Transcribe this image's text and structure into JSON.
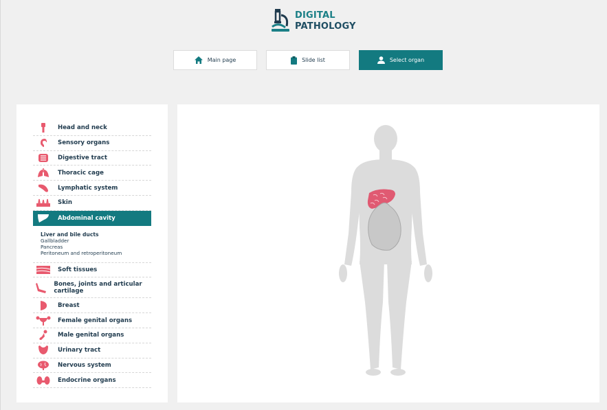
{
  "header": {
    "logo_line1": "DIGITAL",
    "logo_line2": "PATHOLOGY"
  },
  "nav": [
    {
      "label": "Main page",
      "icon": "home-icon"
    },
    {
      "label": "Slide list",
      "icon": "clipboard-icon"
    },
    {
      "label": "Select organ",
      "icon": "user-icon",
      "active": true
    }
  ],
  "organs": [
    {
      "label": "Head and neck",
      "icon": "head-neck-icon"
    },
    {
      "label": "Sensory organs",
      "icon": "ear-icon"
    },
    {
      "label": "Digestive tract",
      "icon": "intestine-icon"
    },
    {
      "label": "Thoracic cage",
      "icon": "lungs-icon"
    },
    {
      "label": "Lymphatic system",
      "icon": "spleen-icon"
    },
    {
      "label": "Skin",
      "icon": "skin-icon"
    },
    {
      "label": "Abdominal cavity",
      "icon": "liver-icon",
      "active": true
    },
    {
      "label": "Soft tissues",
      "icon": "muscle-icon"
    },
    {
      "label": "Bones, joints and articular cartilage",
      "icon": "bone-joint-icon"
    },
    {
      "label": "Breast",
      "icon": "breast-icon"
    },
    {
      "label": "Female genital organs",
      "icon": "uterus-icon"
    },
    {
      "label": "Male genital organs",
      "icon": "male-organ-icon"
    },
    {
      "label": "Urinary tract",
      "icon": "bladder-icon"
    },
    {
      "label": "Nervous system",
      "icon": "brain-icon"
    },
    {
      "label": "Endocrine organs",
      "icon": "thyroid-icon"
    }
  ],
  "subitems": [
    "Liver and bile ducts",
    "Gallbladder",
    "Pancreas",
    "Peritoneum and retroperitoneum"
  ],
  "colors": {
    "accent": "#137a80",
    "organ_icon": "#e85a6e",
    "body_silhouette": "#dcdcdc"
  }
}
